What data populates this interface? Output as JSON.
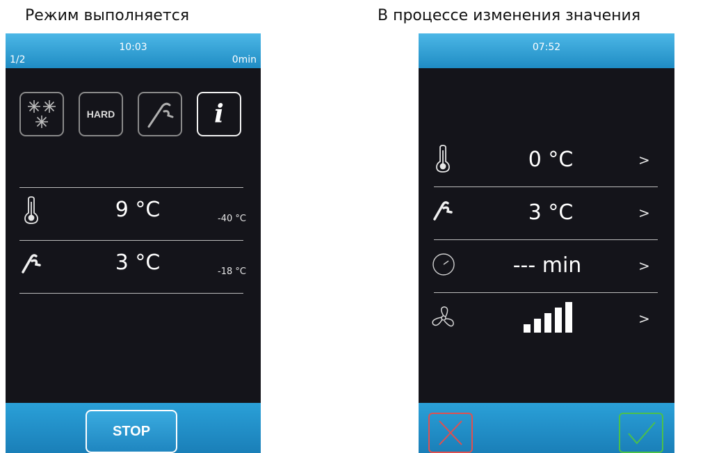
{
  "captions": {
    "left": "Режим выполняется",
    "right": "В процессе изменения значения"
  },
  "left_screen": {
    "header": {
      "page": "1/2",
      "time": "10:03",
      "remaining": "0min"
    },
    "modes": [
      {
        "name": "snowflakes-icon",
        "active": false
      },
      {
        "name": "hard",
        "label": "HARD",
        "active": false
      },
      {
        "name": "probe-icon",
        "active": false
      },
      {
        "name": "info-icon",
        "active": true
      }
    ],
    "rows": [
      {
        "icon": "thermometer-icon",
        "value": "9 °C",
        "setpoint": "-40 °C"
      },
      {
        "icon": "probe-icon",
        "value": "3 °C",
        "setpoint": "-18 °C"
      }
    ],
    "footer": {
      "stop_label": "STOP"
    },
    "colors": {
      "header": "#2a9fd6",
      "background": "#14141a"
    }
  },
  "right_screen": {
    "header": {
      "time": "07:52"
    },
    "rows": [
      {
        "icon": "thermometer-icon",
        "value": "0 °C"
      },
      {
        "icon": "probe-icon",
        "value": "3 °C"
      },
      {
        "icon": "clock-icon",
        "value": "--- min"
      },
      {
        "icon": "fan-icon",
        "value_level": 5,
        "value_max": 5
      }
    ],
    "footer": {
      "cancel_icon": "x-icon",
      "confirm_icon": "check-icon"
    },
    "colors": {
      "cancel": "#e05050",
      "confirm": "#4bc04b"
    }
  }
}
